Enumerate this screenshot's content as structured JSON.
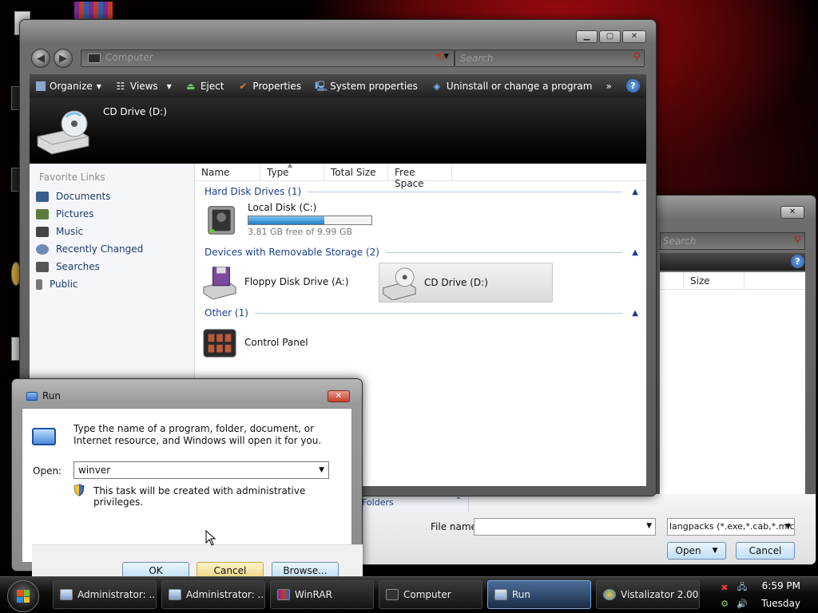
{
  "explorer": {
    "address_text": "Computer",
    "search_placeholder": "Search",
    "toolbar": {
      "organize": "Organize",
      "views": "Views",
      "eject": "Eject",
      "properties": "Properties",
      "system_properties": "System properties",
      "uninstall": "Uninstall or change a program",
      "more": "»"
    },
    "preview_title": "CD Drive (D:)",
    "favorites_heading": "Favorite Links",
    "favorites": [
      {
        "label": "Documents",
        "icon": "documents-icon",
        "color": "#3a5f8f"
      },
      {
        "label": "Pictures",
        "icon": "pictures-icon",
        "color": "#5d7d3e"
      },
      {
        "label": "Music",
        "icon": "music-icon",
        "color": "#444444"
      },
      {
        "label": "Recently Changed",
        "icon": "recent-icon",
        "color": "#6f8db3"
      },
      {
        "label": "Searches",
        "icon": "searches-icon",
        "color": "#555555"
      },
      {
        "label": "Public",
        "icon": "public-icon",
        "color": "#777777"
      }
    ],
    "columns": [
      "Name",
      "Type",
      "Total Size",
      "Free Space"
    ],
    "groups": {
      "hard_disks": "Hard Disk Drives (1)",
      "removable": "Devices with Removable Storage (2)",
      "other": "Other (1)"
    },
    "local_disk": {
      "name": "Local Disk (C:)",
      "free_text": "3.81 GB free of 9.99 GB",
      "used_fraction": 0.62
    },
    "floppy": "Floppy Disk Drive (A:)",
    "cd_drive": "CD Drive (D:)",
    "control_panel": "Control Panel"
  },
  "open_dialog": {
    "search_placeholder": "Search",
    "size_column": "Size",
    "folders_label": "Folders",
    "file_name_label": "File name:",
    "file_type": "langpacks (*.exe,*.cab,*.mlc)",
    "open_label": "Open",
    "cancel_label": "Cancel"
  },
  "run": {
    "title": "Run",
    "description": "Type the name of a program, folder, document, or Internet resource, and Windows will open it for you.",
    "open_label": "Open:",
    "input_value": "winver",
    "admin_note": "This task will be created with administrative privileges.",
    "ok_label": "OK",
    "cancel_label": "Cancel",
    "browse_label": "Browse..."
  },
  "taskbar": {
    "buttons": [
      {
        "label": "Administrator: ...",
        "icon": "cmd-icon"
      },
      {
        "label": "Administrator: ...",
        "icon": "cmd-icon"
      },
      {
        "label": "WinRAR",
        "icon": "winrar-icon"
      },
      {
        "label": "Computer",
        "icon": "computer-icon"
      },
      {
        "label": "Run",
        "icon": "run-icon"
      },
      {
        "label": "Vistalizator 2.00",
        "icon": "vistalizator-icon"
      }
    ],
    "active_button": "Run",
    "clock_time": "6:59 PM",
    "clock_day": "Tuesday"
  }
}
